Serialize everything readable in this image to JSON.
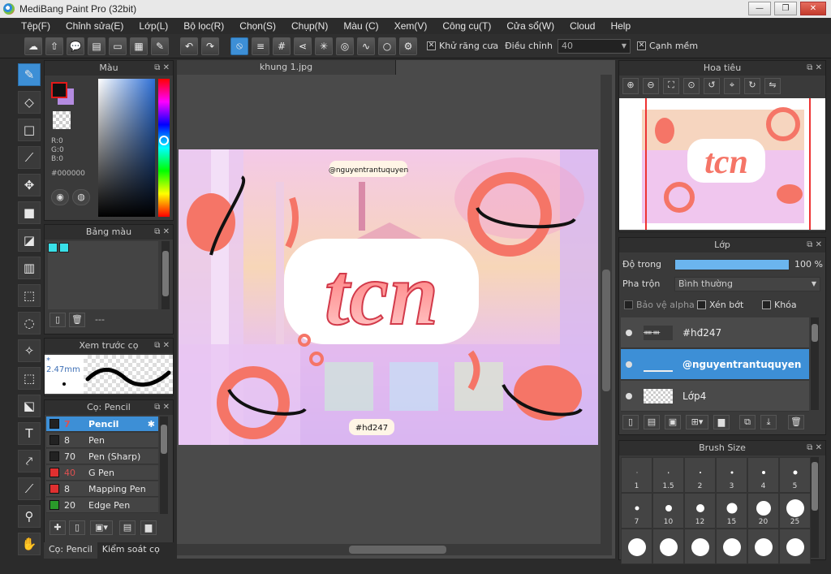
{
  "window": {
    "title": "MediBang Paint Pro (32bit)",
    "min": "—",
    "max": "❐",
    "close": "✕"
  },
  "menu": [
    "Tệp(F)",
    "Chỉnh sửa(E)",
    "Lớp(L)",
    "Bộ lọc(R)",
    "Chọn(S)",
    "Chụp(N)",
    "Màu (C)",
    "Xem(V)",
    "Công cụ(T)",
    "Cửa sổ(W)",
    "Cloud",
    "Help"
  ],
  "toolbar": {
    "antialias_label": "Khử răng cưa",
    "antialias_checked": "✕",
    "correction_label": "Điều chỉnh",
    "correction_value": "40",
    "soft_edge_label": "Cạnh mềm",
    "soft_edge_checked": "✕"
  },
  "color_panel": {
    "title": "Màu",
    "fg_color": "#000000",
    "r": "R:0",
    "g": "G:0",
    "b": "B:0",
    "hex": "#000000"
  },
  "palette_panel": {
    "title": "Bảng màu",
    "swatches": [
      "#39e0e8",
      "#39e0e8"
    ],
    "footer": "---"
  },
  "brush_preview": {
    "title": "Xem trước cọ",
    "size": "* 2.47mm"
  },
  "brush_panel": {
    "title": "Cọ: Pencil",
    "brushes": [
      {
        "size": "7",
        "name": "Pencil",
        "color": "#222222",
        "selected": true
      },
      {
        "size": "8",
        "name": "Pen",
        "color": "#222222"
      },
      {
        "size": "70",
        "name": "Pen (Sharp)",
        "color": "#222222"
      },
      {
        "size": "40",
        "name": "G Pen",
        "color": "#e03030"
      },
      {
        "size": "8",
        "name": "Mapping Pen",
        "color": "#e03030"
      },
      {
        "size": "20",
        "name": "Edge Pen",
        "color": "#2a9a2a"
      }
    ],
    "tabs": [
      "Cọ: Pencil",
      "Kiểm soát cọ"
    ]
  },
  "document": {
    "tab": "khung 1.jpg"
  },
  "artwork": {
    "tag_top": "@nguyentrantuquyen",
    "tag_bottom": "#hđ247",
    "main_text": "tcn"
  },
  "navigator": {
    "title": "Hoa tiêu"
  },
  "layers": {
    "title": "Lớp",
    "opacity_label": "Độ trong",
    "opacity_value": "100 %",
    "opacity": 1.0,
    "blend_label": "Pha trộn",
    "blend_value": "Bình thường",
    "protect_alpha": "Bảo vệ alpha",
    "clipping": "Xén bớt",
    "lock": "Khóa",
    "items": [
      {
        "name": "#hđ247",
        "selected": false
      },
      {
        "name": "@nguyentrantuquyen",
        "selected": true
      },
      {
        "name": "Lớp4",
        "selected": false
      }
    ]
  },
  "brush_size": {
    "title": "Brush Size",
    "sizes": [
      "1",
      "1.5",
      "2",
      "3",
      "4",
      "5",
      "7",
      "10",
      "12",
      "15",
      "20",
      "25",
      "",
      "",
      "",
      "",
      "",
      ""
    ]
  }
}
